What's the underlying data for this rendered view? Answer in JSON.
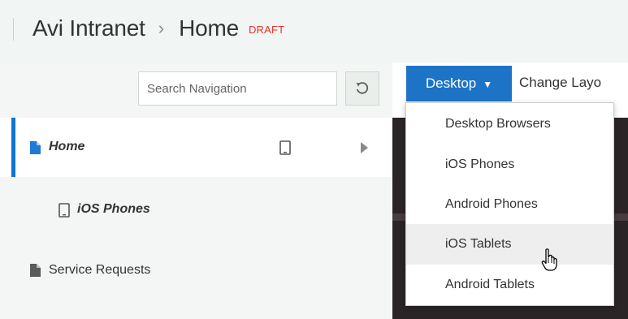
{
  "header": {
    "site": "Avi Intranet",
    "separator": "›",
    "page": "Home",
    "badge": "DRAFT"
  },
  "navigation": {
    "search_placeholder": "Search Navigation",
    "items": [
      {
        "label": "Home",
        "selected": true,
        "icon": "page-icon",
        "device_icon": "tablet-icon",
        "arrow": "caret-right-icon"
      },
      {
        "label": "iOS Phones",
        "selected": false,
        "icon": "phone-device-icon"
      },
      {
        "label": "Service Requests",
        "selected": false,
        "icon": "page-icon"
      }
    ]
  },
  "toolbar": {
    "device_button": "Desktop",
    "change_layout": "Change Layo"
  },
  "device_menu": {
    "items": [
      "Desktop Browsers",
      "iOS Phones",
      "Android Phones",
      "iOS Tablets",
      "Android Tablets"
    ],
    "hovered": "iOS Tablets"
  },
  "colors": {
    "accent": "#1d73c6",
    "selection_bar": "#0f74d1",
    "draft": "#e0342b",
    "header_bg": "#f1f5f3"
  }
}
